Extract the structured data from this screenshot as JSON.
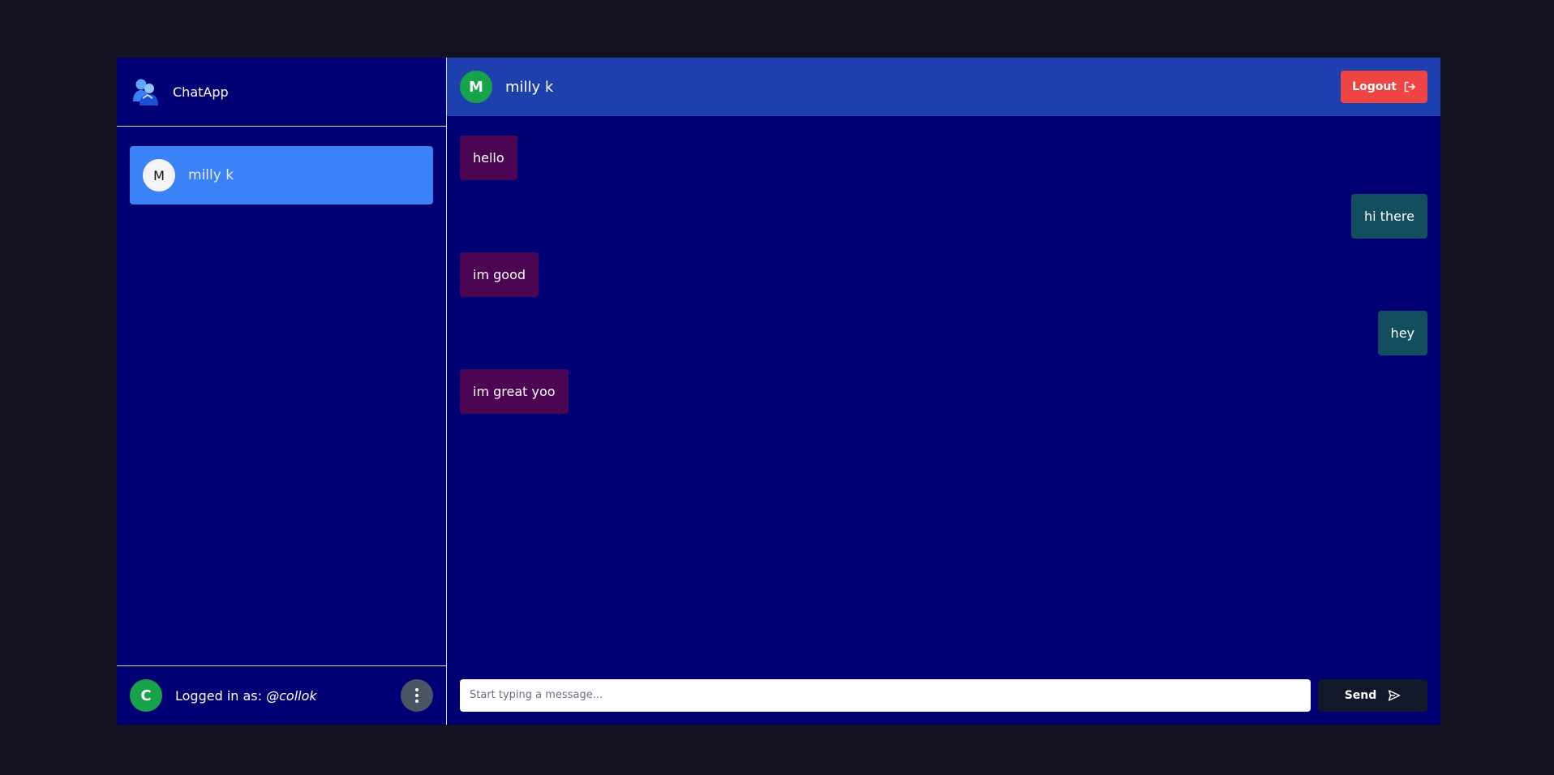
{
  "app": {
    "title": "ChatApp"
  },
  "sidebar": {
    "conversations": [
      {
        "avatar_letter": "M",
        "name": "milly k"
      }
    ],
    "footer": {
      "avatar_letter": "C",
      "logged_in_prefix": "Logged in as:",
      "handle": "@collok"
    }
  },
  "chat": {
    "peer": {
      "avatar_letter": "M",
      "name": "milly k"
    },
    "logout_label": "Logout",
    "messages": [
      {
        "text": "hello",
        "direction": "in"
      },
      {
        "text": "hi there",
        "direction": "out"
      },
      {
        "text": "im good",
        "direction": "in"
      },
      {
        "text": "hey",
        "direction": "out"
      },
      {
        "text": "im great yoo",
        "direction": "in"
      }
    ],
    "composer": {
      "placeholder": "Start typing a message...",
      "value": "",
      "send_label": "Send"
    }
  },
  "colors": {
    "page_bg": "#13121f",
    "app_bg": "#000074",
    "header_bg": "#1e40af",
    "active_conversation": "#3b82f6",
    "incoming_bubble": "#4c0552",
    "outgoing_bubble": "#134e5e",
    "logout": "#ef4444",
    "avatar_green": "#16a34a",
    "send_button": "#111827"
  },
  "icons": {
    "logo": "chat-users-logo-icon",
    "menu": "vertical-dots-icon",
    "logout": "logout-arrow-icon",
    "send": "paper-plane-icon"
  }
}
